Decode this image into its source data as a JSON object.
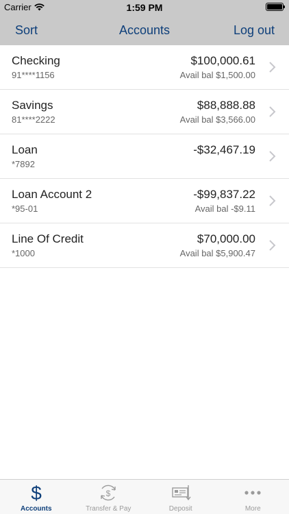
{
  "status_bar": {
    "carrier": "Carrier",
    "time": "1:59 PM"
  },
  "nav": {
    "sort_label": "Sort",
    "title": "Accounts",
    "logout_label": "Log out"
  },
  "accounts": [
    {
      "name": "Checking",
      "number": "91****1156",
      "balance": "$100,000.61",
      "available": "Avail bal $1,500.00"
    },
    {
      "name": "Savings",
      "number": "81****2222",
      "balance": "$88,888.88",
      "available": "Avail bal $3,566.00"
    },
    {
      "name": "Loan",
      "number": "*7892",
      "balance": "-$32,467.19",
      "available": ""
    },
    {
      "name": "Loan Account 2",
      "number": "*95-01",
      "balance": "-$99,837.22",
      "available": "Avail bal -$9.11"
    },
    {
      "name": "Line Of Credit",
      "number": "*1000",
      "balance": "$70,000.00",
      "available": "Avail bal $5,900.47"
    }
  ],
  "tabbar": {
    "tabs": [
      {
        "label": "Accounts",
        "icon": "dollar-icon",
        "active": true
      },
      {
        "label": "Transfer & Pay",
        "icon": "transfer-pay-icon",
        "active": false
      },
      {
        "label": "Deposit",
        "icon": "check-deposit-icon",
        "active": false
      },
      {
        "label": "More",
        "icon": "more-dots-icon",
        "active": false
      }
    ]
  },
  "colors": {
    "accent": "#0e3f7a",
    "header_bg": "#c9c9c9",
    "inactive_tab": "#9a9a9a"
  }
}
